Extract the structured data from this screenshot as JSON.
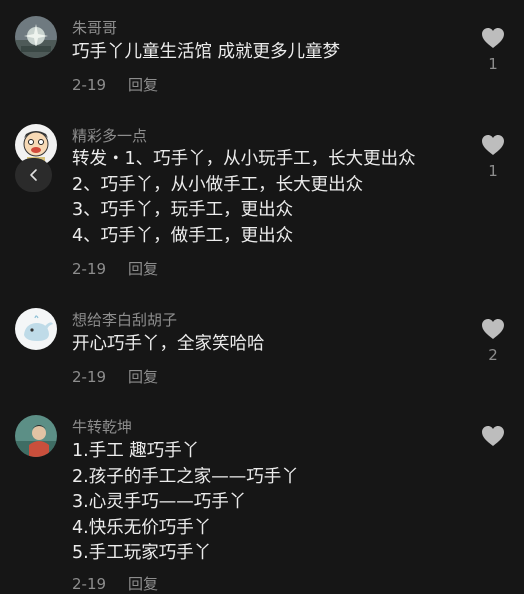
{
  "comments": [
    {
      "username": "朱哥哥",
      "lines": [
        "巧手丫儿童生活馆 成就更多儿童梦"
      ],
      "date": "2-19",
      "reply_label": "回复",
      "like_count": "1"
    },
    {
      "username": "精彩多一点",
      "lines": [
        "转发・1、巧手丫，从小玩手工，长大更出众",
        "2、巧手丫，从小做手工，长大更出众",
        "3、巧手丫，玩手工，更出众",
        "4、巧手丫，做手工，更出众"
      ],
      "date": "2-19",
      "reply_label": "回复",
      "like_count": "1"
    },
    {
      "username": "想给李白刮胡子",
      "lines": [
        "开心巧手丫，全家笑哈哈"
      ],
      "date": "2-19",
      "reply_label": "回复",
      "like_count": "2"
    },
    {
      "username": "牛转乾坤",
      "lines": [
        "1.手工 趣巧手丫",
        "2.孩子的手工之家——巧手丫",
        "3.心灵手巧——巧手丫",
        "4.快乐无价巧手丫",
        "5.手工玩家巧手丫"
      ],
      "date": "2-19",
      "reply_label": "回复",
      "like_count": ""
    }
  ],
  "icons": {
    "like": "heart-icon",
    "back": "chevron-left-icon"
  },
  "colors": {
    "background": "#161616",
    "primary_text": "#ececec",
    "secondary_text": "#8d8d8d",
    "heart": "#bdbdbd"
  }
}
